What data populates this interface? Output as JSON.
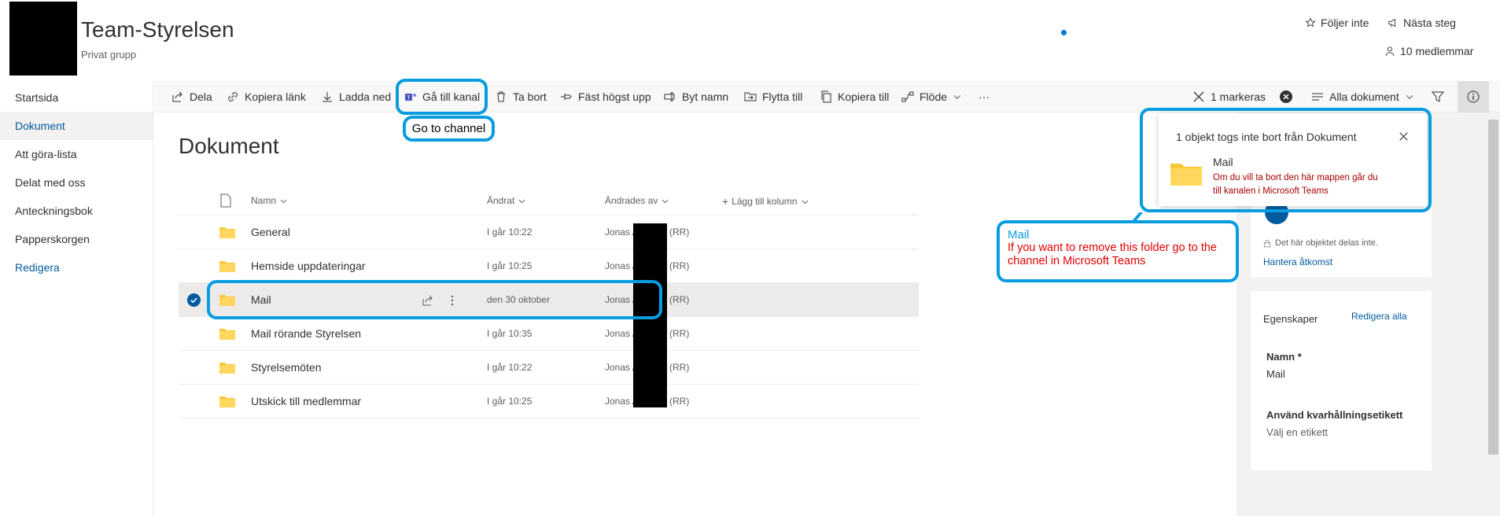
{
  "site": {
    "title": "Team-Styrelsen",
    "subtitle": "Privat grupp"
  },
  "header": {
    "follow_label": "Följer inte",
    "next_step_label": "Nästa steg",
    "members_label": "10 medlemmar"
  },
  "nav": {
    "items": [
      {
        "label": "Startsida"
      },
      {
        "label": "Dokument"
      },
      {
        "label": "Att göra-lista"
      },
      {
        "label": "Delat med oss"
      },
      {
        "label": "Anteckningsbok"
      },
      {
        "label": "Papperskorgen"
      },
      {
        "label": "Redigera"
      }
    ]
  },
  "toolbar": {
    "share": "Dela",
    "copy_link": "Kopiera länk",
    "download": "Ladda ned",
    "go_to_channel": "Gå till kanal",
    "delete": "Ta bort",
    "pin": "Fäst högst upp",
    "rename": "Byt namn",
    "move": "Flytta till",
    "copy": "Kopiera till",
    "flow": "Flöde",
    "more": "···",
    "selected": "1 markeras",
    "view": "Alla dokument"
  },
  "annotations": {
    "go_to_channel_callout": "Go to channel",
    "mail_callout_title": "Mail",
    "mail_callout_text": "If you want to remove this folder go to the channel in Microsoft Teams"
  },
  "library": {
    "title": "Dokument",
    "columns": {
      "name": "Namn",
      "modified": "Ändrat",
      "modified_by": "Ändrades av",
      "add_column": "Lägg till kolumn"
    },
    "rows": [
      {
        "name": "General",
        "modified": "I går 10:22",
        "by": "Jonas A",
        "rr": "(RR)"
      },
      {
        "name": "Hemside uppdateringar",
        "modified": "I går 10:25",
        "by": "Jonas A",
        "rr": "(RR)"
      },
      {
        "name": "Mail",
        "modified": "den 30 oktober",
        "by": "Jonas A",
        "rr": "(RR)"
      },
      {
        "name": "Mail rörande Styrelsen",
        "modified": "I går 10:35",
        "by": "Jonas A",
        "rr": "(RR)"
      },
      {
        "name": "Styrelsemöten",
        "modified": "I går 10:22",
        "by": "Jonas A",
        "rr": "(RR)"
      },
      {
        "name": "Utskick till medlemmar",
        "modified": "I går 10:25",
        "by": "Jonas A",
        "rr": "(RR)"
      }
    ]
  },
  "popup": {
    "message": "1 objekt togs inte bort från Dokument",
    "item_name": "Mail",
    "item_error": "Om du vill ta bort den här mappen går du till kanalen i Microsoft Teams"
  },
  "details": {
    "not_shared": "Det här objektet delas inte.",
    "manage_access": "Hantera åtkomst",
    "properties_title": "Egenskaper",
    "edit_all": "Redigera alla",
    "name_label": "Namn *",
    "name_value": "Mail",
    "retention_label": "Använd kvarhållningsetikett",
    "retention_value": "Välj en etikett"
  },
  "colors": {
    "accent": "#0078d4",
    "callout": "#0a9ce0",
    "error": "#a80000",
    "folder": "#f8c83a"
  }
}
